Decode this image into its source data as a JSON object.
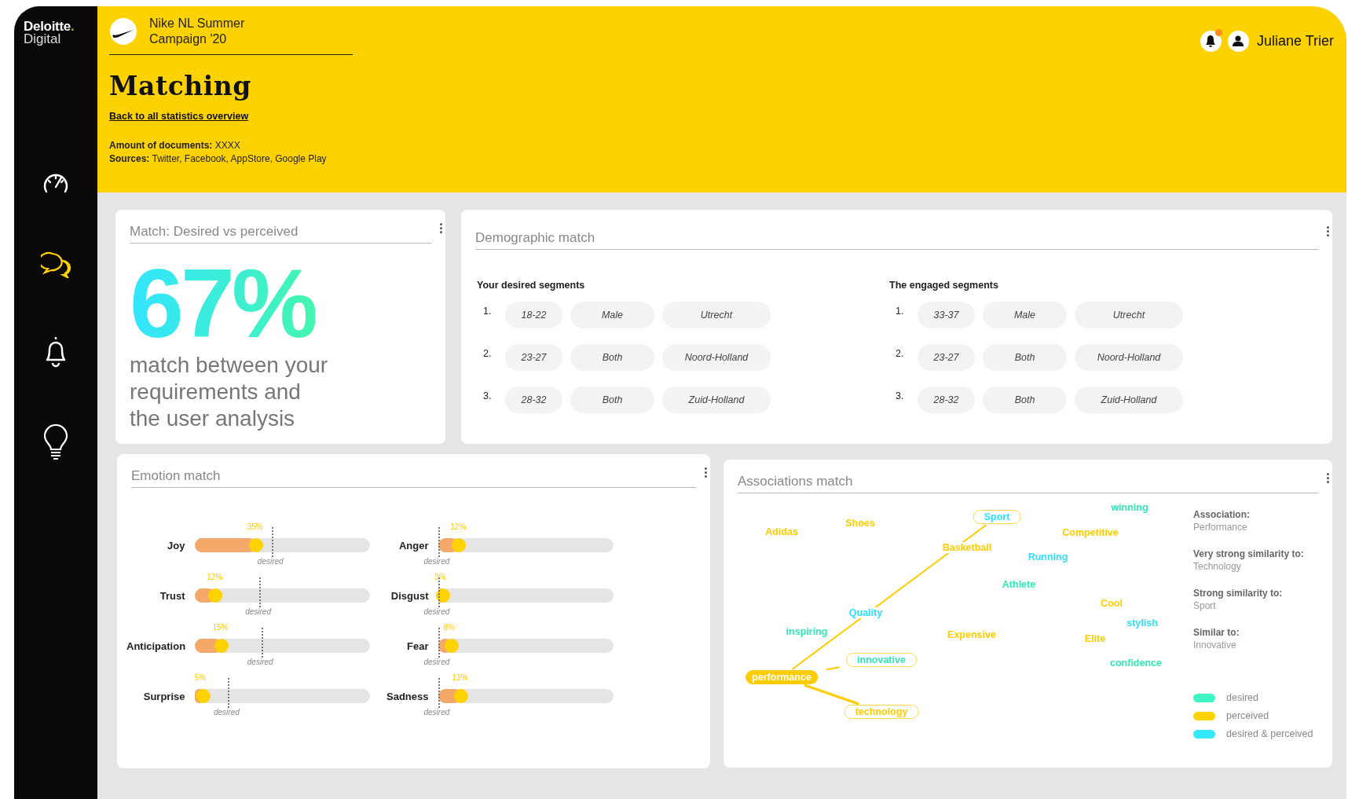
{
  "sidebar": {
    "logo": {
      "brand": "Deloitte.",
      "sub": "Digital"
    },
    "items": [
      {
        "kind": "gauge",
        "selected": false
      },
      {
        "kind": "chat",
        "selected": true
      },
      {
        "kind": "bell",
        "selected": false
      },
      {
        "kind": "bulb",
        "selected": false
      }
    ]
  },
  "header": {
    "campaign": "Nike NL Summer Campaign '20",
    "title": "Matching",
    "back_link": "Back to all statistics overview",
    "meta": [
      {
        "label": "Amount of documents:",
        "value": "XXXX"
      },
      {
        "label": "Sources:",
        "value": "Twitter, Facebook, AppStore, Google Play"
      }
    ],
    "notifications": {
      "unread": true
    },
    "user": "Juliane Trier"
  },
  "match_card": {
    "title": "Match: Desired vs perceived",
    "percent": "67%",
    "text": "match between your requirements and the user analysis"
  },
  "demographic": {
    "title": "Demographic match",
    "groups": [
      {
        "heading": "Your desired segments",
        "rows": [
          {
            "num": "1.",
            "age": "18-22",
            "gender": "Male",
            "region": "Utrecht"
          },
          {
            "num": "2.",
            "age": "23-27",
            "gender": "Both",
            "region": "Noord-Holland"
          },
          {
            "num": "3.",
            "age": "28-32",
            "gender": "Both",
            "region": "Zuid-Holland"
          }
        ]
      },
      {
        "heading": "The engaged segments",
        "rows": [
          {
            "num": "1.",
            "age": "33-37",
            "gender": "Male",
            "region": "Utrecht"
          },
          {
            "num": "2.",
            "age": "23-27",
            "gender": "Both",
            "region": "Noord-Holland"
          },
          {
            "num": "3.",
            "age": "28-32",
            "gender": "Both",
            "region": "Zuid-Holland"
          }
        ]
      }
    ]
  },
  "emotion": {
    "title": "Emotion match",
    "items": [
      {
        "name": "Joy",
        "value": "35%",
        "level": 0.35,
        "desired": {
          "label": "desired",
          "level": 0.44
        }
      },
      {
        "name": "Anger",
        "value": "12%",
        "level": 0.12,
        "desired": {
          "label": "desired",
          "level": 0
        }
      },
      {
        "name": "Trust",
        "value": "12%",
        "level": 0.12,
        "desired": {
          "label": "desired",
          "level": 0.37
        }
      },
      {
        "name": "Disgust",
        "value": "3%",
        "level": 0.03,
        "desired": {
          "label": "desired",
          "level": 0
        }
      },
      {
        "name": "Anticipation",
        "value": "15%",
        "level": 0.15,
        "desired": {
          "label": "desired",
          "level": 0.38
        }
      },
      {
        "name": "Fear",
        "value": "8%",
        "level": 0.08,
        "desired": {
          "label": "desired",
          "level": 0
        }
      },
      {
        "name": "Surprise",
        "value": "5%",
        "level": 0.05,
        "desired": {
          "label": "desired",
          "level": 0.19
        }
      },
      {
        "name": "Sadness",
        "value": "13%",
        "level": 0.13,
        "desired": {
          "label": "desired",
          "level": 0
        }
      }
    ]
  },
  "associations": {
    "title": "Associations match",
    "words": [
      {
        "text": "winning",
        "kind": "desired",
        "selected": false,
        "linked": false
      },
      {
        "text": "Sport",
        "kind": "both",
        "selected": false,
        "linked": true
      },
      {
        "text": "Shoes",
        "kind": "perceived",
        "selected": false,
        "linked": false
      },
      {
        "text": "Adidas",
        "kind": "perceived",
        "selected": false,
        "linked": false
      },
      {
        "text": "Competitive",
        "kind": "perceived",
        "selected": false,
        "linked": false
      },
      {
        "text": "Basketball",
        "kind": "perceived",
        "selected": false,
        "linked": false
      },
      {
        "text": "Running",
        "kind": "both",
        "selected": false,
        "linked": false
      },
      {
        "text": "Athlete",
        "kind": "desired",
        "selected": false,
        "linked": false
      },
      {
        "text": "Cool",
        "kind": "perceived",
        "selected": false,
        "linked": false
      },
      {
        "text": "Quality",
        "kind": "both",
        "selected": false,
        "linked": false
      },
      {
        "text": "stylish",
        "kind": "both",
        "selected": false,
        "linked": false
      },
      {
        "text": "inspiring",
        "kind": "desired",
        "selected": false,
        "linked": false
      },
      {
        "text": "Expensive",
        "kind": "perceived",
        "selected": false,
        "linked": false
      },
      {
        "text": "Elite",
        "kind": "perceived",
        "selected": false,
        "linked": false
      },
      {
        "text": "innovative",
        "kind": "desired",
        "selected": false,
        "linked": true
      },
      {
        "text": "confidence",
        "kind": "desired",
        "selected": false,
        "linked": false
      },
      {
        "text": "performance",
        "kind": "perceived",
        "selected": true,
        "linked": false
      },
      {
        "text": "technology",
        "kind": "perceived",
        "selected": false,
        "linked": true
      }
    ],
    "info": [
      {
        "label": "Association:",
        "value": "Performance"
      },
      {
        "label": "Very strong similarity to:",
        "value": "Technology"
      },
      {
        "label": "Strong similarity to:",
        "value": "Sport"
      },
      {
        "label": "Similar to:",
        "value": "Innovative"
      }
    ],
    "legend": [
      {
        "label": "desired",
        "color": "#3ff5c2"
      },
      {
        "label": "perceived",
        "color": "#ffd200"
      },
      {
        "label": "desired & perceived",
        "color": "#33e8ff"
      }
    ]
  }
}
